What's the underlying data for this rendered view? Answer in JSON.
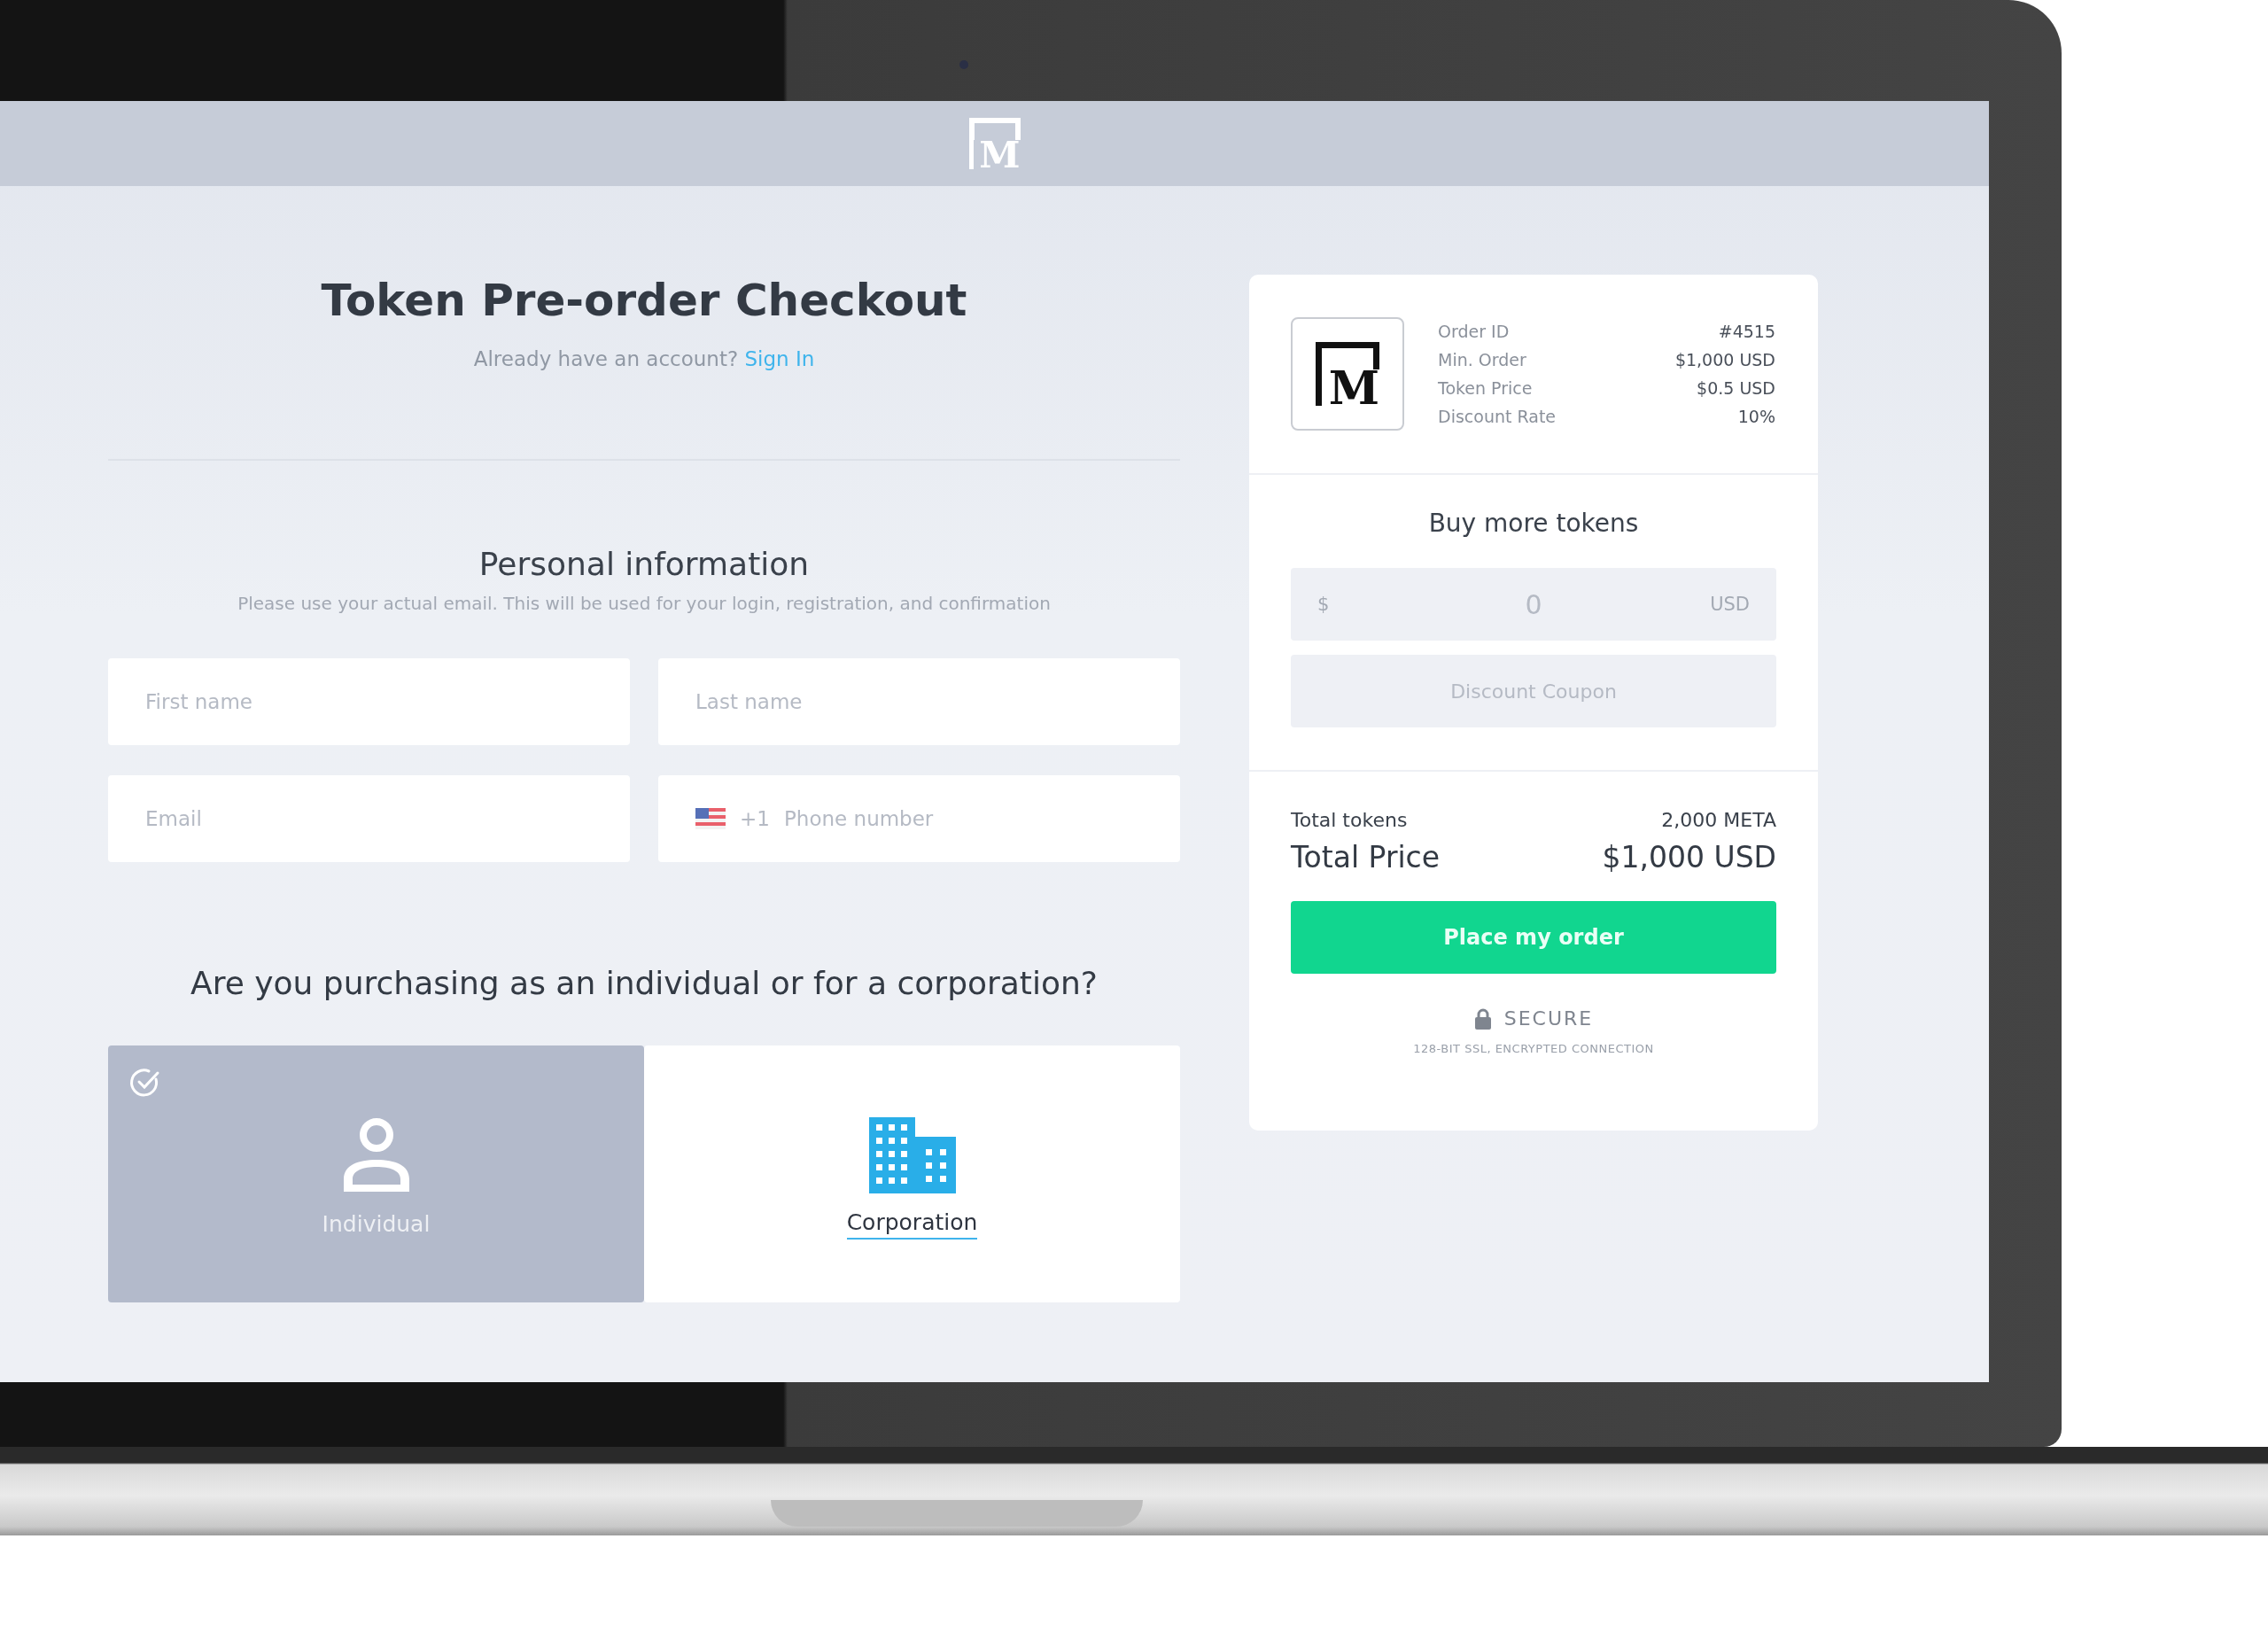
{
  "header": {
    "logo_letter": "M"
  },
  "checkout": {
    "title": "Token Pre-order Checkout",
    "account_prompt": "Already have an account?",
    "sign_in_link": "Sign In"
  },
  "personal_info": {
    "heading": "Personal information",
    "hint": "Please use your actual email. This will be used for your login, registration, and confirmation",
    "fields": [
      {
        "kind": "text",
        "placeholder": "First name"
      },
      {
        "kind": "text",
        "placeholder": "Last name"
      },
      {
        "kind": "text",
        "placeholder": "Email"
      },
      {
        "kind": "phone",
        "country_code": "+1",
        "placeholder": "Phone number"
      }
    ]
  },
  "purchaser_type": {
    "question": "Are you purchasing as an individual or for a corporation?",
    "options": [
      {
        "kind": "individual",
        "label": "Individual",
        "selected": true
      },
      {
        "kind": "corporation",
        "label": "Corporation",
        "selected": false
      }
    ]
  },
  "order_summary": {
    "logo_letter": "M",
    "details": [
      {
        "label": "Order ID",
        "value": "#4515"
      },
      {
        "label": "Min. Order",
        "value": "$1,000 USD"
      },
      {
        "label": "Token Price",
        "value": "$0.5 USD"
      },
      {
        "label": "Discount Rate",
        "value": "10%"
      }
    ],
    "buy_more": {
      "heading": "Buy more tokens",
      "amount": {
        "prefix": "$",
        "placeholder": "0",
        "suffix": "USD"
      },
      "coupon": {
        "placeholder": "Discount Coupon"
      }
    },
    "totals": {
      "tokens_label": "Total tokens",
      "tokens_value": "2,000 META",
      "price_label": "Total Price",
      "price_value": "$1,000 USD"
    },
    "order_button": "Place my order",
    "secure": {
      "label": "SECURE",
      "note": "128-BIT SSL, ENCRYPTED CONNECTION"
    }
  }
}
